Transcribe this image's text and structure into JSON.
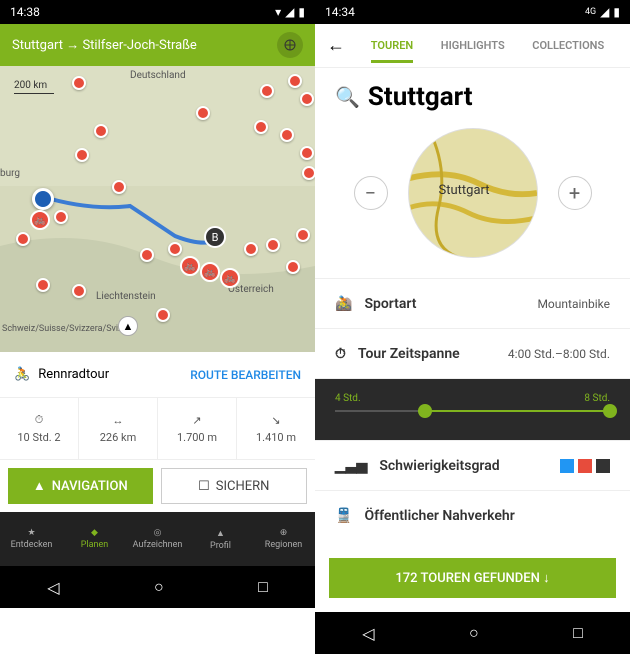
{
  "left": {
    "status_time": "14:38",
    "header_title": "Stuttgart → Stilfser-Joch-Straße",
    "map": {
      "scale": "200 km",
      "countries": [
        "Deutschland",
        "Liechtenstein",
        "Österreich",
        "Schweiz/Suisse/Svizzera/Svizra"
      ],
      "city": "burg"
    },
    "route_type": "Rennradtour",
    "edit_route": "ROUTE BEARBEITEN",
    "stats": {
      "duration": "10 Std. 2",
      "distance": "226 km",
      "ascent": "1.700 m",
      "descent": "1.410 m"
    },
    "nav_button": "NAVIGATION",
    "save_button": "SICHERN",
    "bottom_nav": [
      "Entdecken",
      "Planen",
      "Aufzeichnen",
      "Profil",
      "Regionen"
    ]
  },
  "right": {
    "status_time": "14:34",
    "tabs": [
      "TOUREN",
      "HIGHLIGHTS",
      "COLLECTIONS"
    ],
    "search_label": "Stuttgart",
    "map_label": "Stuttgart",
    "filters": {
      "sport_label": "Sportart",
      "sport_value": "Mountainbike",
      "duration_label": "Tour Zeitspanne",
      "duration_value": "4:00 Std.–8:00 Std.",
      "slider_min": "4 Std.",
      "slider_max": "8 Std.",
      "difficulty_label": "Schwierigkeitsgrad",
      "transit_label": "Öffentlicher Nahverkehr"
    },
    "results": "172 TOUREN GEFUNDEN ↓"
  }
}
